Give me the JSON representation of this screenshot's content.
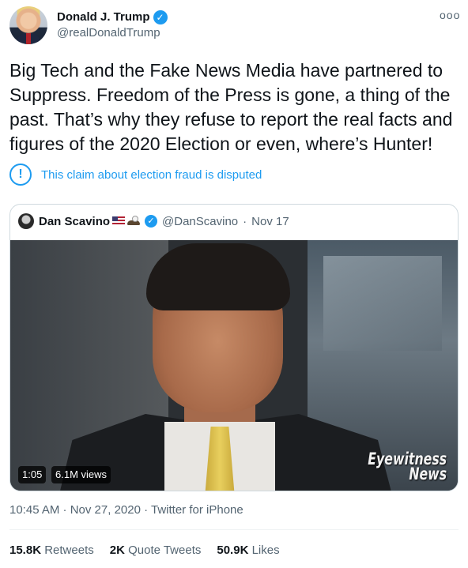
{
  "author": {
    "display_name": "Donald J. Trump",
    "handle": "@realDonaldTrump",
    "verified_icon": "✓",
    "more_icon": "ooo"
  },
  "tweet": {
    "text": "Big Tech and the Fake News Media have partnered to Suppress. Freedom of the Press is gone, a thing of the past. That’s why they refuse to report the real facts and figures of the 2020 Election or even, where’s Hunter!"
  },
  "notice": {
    "icon": "!",
    "text": "This claim about election fraud is disputed"
  },
  "quoted_tweet": {
    "display_name": "Dan Scavino",
    "handle": "@DanScavino",
    "date": "Nov 17",
    "separator": "·",
    "verified_icon": "✓",
    "video": {
      "duration": "1:05",
      "views": "6.1M views",
      "logo_line1": "Eyewitness",
      "logo_line2": "News"
    }
  },
  "timestamp": "10:45 AM · Nov 27, 2020 · Twitter for iPhone",
  "stats": {
    "retweets_count": "15.8K",
    "retweets_label": "Retweets",
    "quotes_count": "2K",
    "quotes_label": "Quote Tweets",
    "likes_count": "50.9K",
    "likes_label": "Likes"
  },
  "colors": {
    "accent": "#1d9bf0",
    "text": "#0f1419",
    "secondary": "#536471",
    "border": "#cfd9de"
  }
}
